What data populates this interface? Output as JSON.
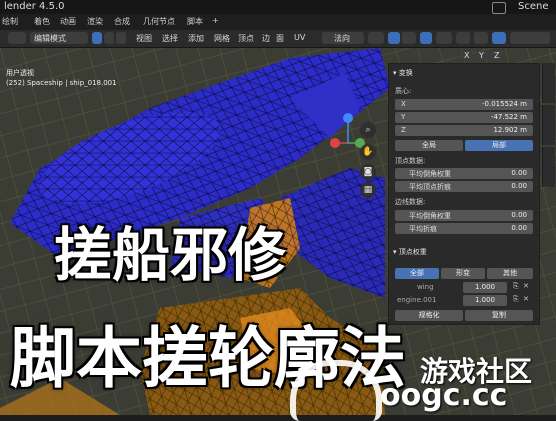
{
  "title_bar": {
    "app_title": "lender 4.5.0",
    "scene_label": "Scene"
  },
  "workspaces": [
    "绘制",
    "着色",
    "动画",
    "渲染",
    "合成",
    "几何节点",
    "脚本",
    "+"
  ],
  "header": {
    "mode": "编辑模式",
    "menus": [
      "视图",
      "选择",
      "添加",
      "网格",
      "顶点",
      "边",
      "面",
      "UV"
    ],
    "orientation": "法向",
    "axes": [
      "X",
      "Y",
      "Z"
    ]
  },
  "viewport": {
    "view_name": "用户透视",
    "object_info": "(252) Spaceship | ship_018.001"
  },
  "npanel": {
    "transform_title": "变换",
    "median_label": "质心:",
    "coords": [
      {
        "axis": "X",
        "value": "-0.015524 m"
      },
      {
        "axis": "Y",
        "value": "-47.522 m"
      },
      {
        "axis": "Z",
        "value": "12.902 m"
      }
    ],
    "space_buttons": [
      "全局",
      "局部"
    ],
    "vertex_data_label": "顶点数据:",
    "vertex_rows": [
      {
        "label": "平均倒角权重",
        "value": "0.00"
      },
      {
        "label": "平均顶点折痕",
        "value": "0.00"
      }
    ],
    "edge_data_label": "边线数据:",
    "edge_rows": [
      {
        "label": "平均倒角权重",
        "value": "0.00"
      },
      {
        "label": "平均折痕",
        "value": "0.00"
      }
    ],
    "vertex_weights_title": "顶点权重",
    "weight_tabs": [
      "全部",
      "形变",
      "其他"
    ],
    "weights": [
      {
        "name": "wing",
        "value": "1.000"
      },
      {
        "name": "engine.001",
        "value": "1.000"
      }
    ],
    "weight_buttons": [
      "规格化",
      "复制"
    ]
  },
  "overlay": {
    "line1": "搓船邪修",
    "line2": "脚本搓轮廓法"
  },
  "watermark": {
    "line1": "游戏社区",
    "line2": "oogc.cc"
  },
  "colors": {
    "mesh_blue": "#2f2fd0",
    "mesh_orange": "#f0921e",
    "panel_bg": "#2a2a2a",
    "accent": "#4772b3"
  }
}
